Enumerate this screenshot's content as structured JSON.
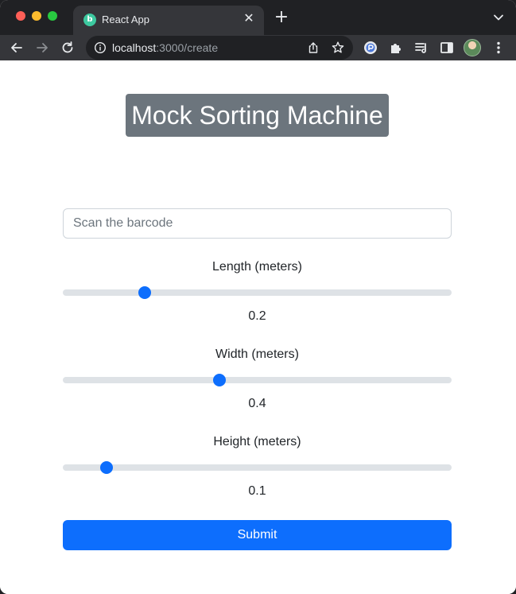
{
  "browser": {
    "tab_title": "React App",
    "tab_favicon_letter": "b",
    "tab_close": "✕",
    "new_tab": "+",
    "url_host": "localhost",
    "url_path": ":3000/create"
  },
  "page": {
    "title": "Mock Sorting Machine",
    "barcode": {
      "placeholder": "Scan the barcode",
      "value": ""
    },
    "sliders": [
      {
        "label": "Length (meters)",
        "value": "0.2",
        "level": 0.2
      },
      {
        "label": "Width (meters)",
        "value": "0.4",
        "level": 0.4
      },
      {
        "label": "Height (meters)",
        "value": "0.1",
        "level": 0.1
      }
    ],
    "submit_label": "Submit"
  },
  "colors": {
    "accent": "#0d6efd",
    "title_bg": "#6c757d",
    "track": "#dee2e6"
  }
}
